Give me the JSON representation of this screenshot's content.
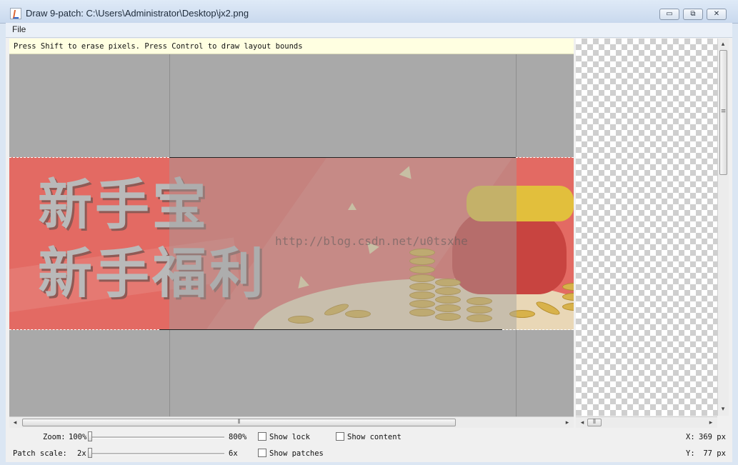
{
  "window": {
    "title": "Draw 9-patch: C:\\Users\\Administrator\\Desktop\\jx2.png",
    "minimize_glyph": "▭",
    "restore_glyph": "⧉",
    "close_glyph": "✕"
  },
  "menu": {
    "file": "File"
  },
  "hint": "Press Shift to erase pixels. Press Control to draw layout bounds",
  "image": {
    "line1": "新手宝",
    "line2": "新手福利",
    "watermark": "http://blog.csdn.net/u0tsxhe"
  },
  "scrollbars": {
    "left_arrow": "◂",
    "right_arrow": "▸",
    "up_arrow": "▴",
    "down_arrow": "▾",
    "grip_h": "⦀",
    "grip_v": "≡"
  },
  "controls": {
    "zoom_label": "Zoom:",
    "zoom_value": "100%",
    "zoom_max": "800%",
    "patch_scale_label": "Patch scale:",
    "patch_scale_value": "2x",
    "patch_scale_max": "6x",
    "show_lock": "Show lock",
    "show_content": "Show content",
    "show_patches": "Show patches",
    "show_lock_checked": false,
    "show_content_checked": false,
    "show_patches_checked": false
  },
  "coords": {
    "x_label": "X:",
    "x_value": "369 px",
    "y_label": "Y:",
    "y_value": " 77 px"
  },
  "colors": {
    "banner_red": "#e36a63",
    "hint_bg": "#ffffe1",
    "editor_gray": "#a9a9a9"
  }
}
